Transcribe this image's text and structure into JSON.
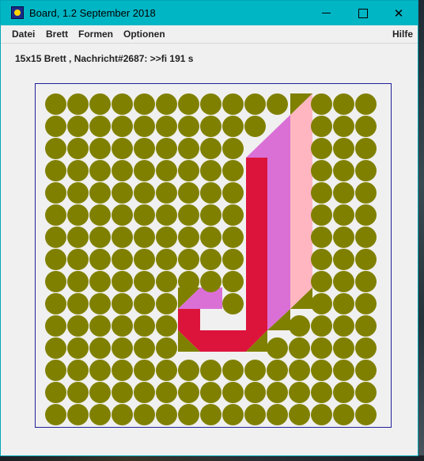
{
  "window": {
    "title": "Board, 1.2 September 2018",
    "icon": "board-app-icon",
    "controls": [
      "minimize-icon",
      "maximize-icon",
      "close-icon"
    ],
    "close_glyph": "✕"
  },
  "menu": {
    "items": [
      "Datei",
      "Brett",
      "Formen",
      "Optionen"
    ],
    "help": "Hilfe"
  },
  "status": {
    "text": "15x15 Brett , Nachricht#2687: >>fi 191 s"
  },
  "board": {
    "rows": 15,
    "cols": 15,
    "cell_color": "#808000",
    "background_color": "#f0f0f0",
    "border_color": "#20209a",
    "shape_colors": {
      "red": "#dc143c",
      "violet": "#da70d6",
      "pink": "#ffb6c1",
      "olive": "#808000"
    }
  }
}
